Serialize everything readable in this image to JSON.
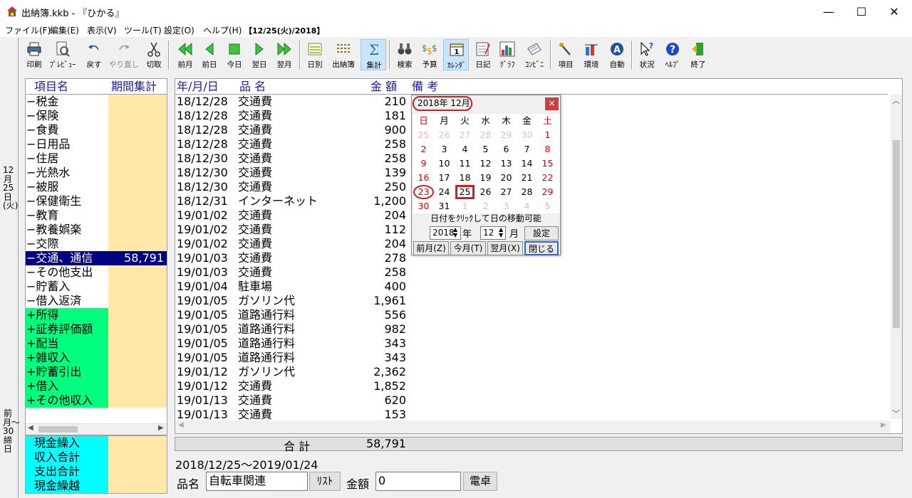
{
  "window": {
    "title": "出納簿.kkb - 『ひかる』",
    "minimize": "—",
    "maximize": "☐",
    "close": "✕"
  },
  "menu": [
    {
      "label": "ファイル(F)"
    },
    {
      "label": "編集(E)"
    },
    {
      "label": "表示(V)"
    },
    {
      "label": "ツール(T)"
    },
    {
      "label": "設定(O)"
    },
    {
      "label": "ヘルプ(H)"
    },
    {
      "label": "【12/25(火)/2018】"
    }
  ],
  "toolbar": [
    {
      "label": "印刷",
      "icon": "printer-icon"
    },
    {
      "label": "ﾌﾟﾚﾋﾞｭｰ",
      "icon": "preview-icon"
    },
    {
      "label": "戻す",
      "icon": "undo-icon"
    },
    {
      "label": "やり直し",
      "icon": "redo-icon"
    },
    {
      "label": "切取",
      "icon": "scissors-icon"
    },
    {
      "label": "前月",
      "icon": "double-left-icon"
    },
    {
      "label": "前日",
      "icon": "left-icon"
    },
    {
      "label": "今日",
      "icon": "square-icon"
    },
    {
      "label": "翌日",
      "icon": "right-icon"
    },
    {
      "label": "翌月",
      "icon": "double-right-icon"
    },
    {
      "label": "日別",
      "icon": "daily-icon"
    },
    {
      "label": "出納簿",
      "icon": "ledger-icon"
    },
    {
      "label": "集計",
      "icon": "sigma-icon"
    },
    {
      "label": "検索",
      "icon": "binoculars-icon"
    },
    {
      "label": "予算",
      "icon": "budget-icon"
    },
    {
      "label": "ｶﾚﾝﾀﾞ",
      "icon": "calendar-icon"
    },
    {
      "label": "日記",
      "icon": "diary-icon"
    },
    {
      "label": "ｸﾞﾗﾌ",
      "icon": "graph-icon"
    },
    {
      "label": "ｺﾝﾋﾞﾆ",
      "icon": "receipt-icon"
    },
    {
      "label": "項目",
      "icon": "items-icon"
    },
    {
      "label": "環境",
      "icon": "environment-icon"
    },
    {
      "label": "自動",
      "icon": "auto-icon"
    },
    {
      "label": "状況",
      "icon": "status-icon"
    },
    {
      "label": "ﾍﾙﾌﾟ",
      "icon": "help-icon"
    },
    {
      "label": "終了",
      "icon": "exit-icon"
    }
  ],
  "vertical_strip": {
    "date": "12月25日(火)",
    "period": "前月〜30締日"
  },
  "left_panel": {
    "header_name": "項目名",
    "header_total": "期間集計",
    "items": [
      {
        "name": "−税金",
        "amount": ""
      },
      {
        "name": "−保険",
        "amount": ""
      },
      {
        "name": "−食費",
        "amount": ""
      },
      {
        "name": "−日用品",
        "amount": ""
      },
      {
        "name": "−住居",
        "amount": ""
      },
      {
        "name": "−光熱水",
        "amount": ""
      },
      {
        "name": "−被服",
        "amount": ""
      },
      {
        "name": "−保健衛生",
        "amount": ""
      },
      {
        "name": "−教育",
        "amount": ""
      },
      {
        "name": "−教養娯楽",
        "amount": ""
      },
      {
        "name": "−交際",
        "amount": ""
      },
      {
        "name": "−交通、通信",
        "amount": "58,791"
      },
      {
        "name": "−その他支出",
        "amount": ""
      },
      {
        "name": "−貯蓄入",
        "amount": ""
      },
      {
        "name": "−借入返済",
        "amount": ""
      },
      {
        "name": "+所得",
        "amount": ""
      },
      {
        "name": "+証券評価額",
        "amount": ""
      },
      {
        "name": "+配当",
        "amount": ""
      },
      {
        "name": "+雑収入",
        "amount": ""
      },
      {
        "name": "+貯蓄引出",
        "amount": ""
      },
      {
        "name": "+借入",
        "amount": ""
      },
      {
        "name": "+その他収入",
        "amount": ""
      }
    ],
    "totals": [
      {
        "name": "現金繰入"
      },
      {
        "name": "収入合計"
      },
      {
        "name": "支出合計"
      },
      {
        "name": "現金繰越"
      }
    ]
  },
  "main_list": {
    "header_date": "年/月/日",
    "header_item": "品 名",
    "header_amount": "金 額",
    "header_note": "備 考",
    "rows": [
      {
        "date": "18/12/28",
        "item": "交通費",
        "amount": "210"
      },
      {
        "date": "18/12/28",
        "item": "交通費",
        "amount": "181"
      },
      {
        "date": "18/12/28",
        "item": "交通費",
        "amount": "900"
      },
      {
        "date": "18/12/28",
        "item": "交通費",
        "amount": "258"
      },
      {
        "date": "18/12/30",
        "item": "交通費",
        "amount": "258"
      },
      {
        "date": "18/12/30",
        "item": "交通費",
        "amount": "139"
      },
      {
        "date": "18/12/30",
        "item": "交通費",
        "amount": "250"
      },
      {
        "date": "18/12/31",
        "item": "インターネット",
        "amount": "1,200"
      },
      {
        "date": "19/01/02",
        "item": "交通費",
        "amount": "204"
      },
      {
        "date": "19/01/02",
        "item": "交通費",
        "amount": "112"
      },
      {
        "date": "19/01/02",
        "item": "交通費",
        "amount": "204"
      },
      {
        "date": "19/01/03",
        "item": "交通費",
        "amount": "278"
      },
      {
        "date": "19/01/03",
        "item": "交通費",
        "amount": "258"
      },
      {
        "date": "19/01/04",
        "item": "駐車場",
        "amount": "400"
      },
      {
        "date": "19/01/05",
        "item": "ガソリン代",
        "amount": "1,961"
      },
      {
        "date": "19/01/05",
        "item": "道路通行料",
        "amount": "556"
      },
      {
        "date": "19/01/05",
        "item": "道路通行料",
        "amount": "982"
      },
      {
        "date": "19/01/05",
        "item": "道路通行料",
        "amount": "343"
      },
      {
        "date": "19/01/05",
        "item": "道路通行料",
        "amount": "343"
      },
      {
        "date": "19/01/12",
        "item": "ガソリン代",
        "amount": "2,362"
      },
      {
        "date": "19/01/12",
        "item": "交通費",
        "amount": "1,852"
      },
      {
        "date": "19/01/13",
        "item": "交通費",
        "amount": "620"
      },
      {
        "date": "19/01/13",
        "item": "交通費",
        "amount": "153"
      }
    ],
    "sum_label": "合 計",
    "sum_value": "58,791"
  },
  "calendar": {
    "title": "2018年 12月",
    "close": "×",
    "weekdays": [
      "日",
      "月",
      "火",
      "水",
      "木",
      "金",
      "土"
    ],
    "days": [
      "25",
      "26",
      "27",
      "28",
      "29",
      "30",
      "1",
      "2",
      "3",
      "4",
      "5",
      "6",
      "7",
      "8",
      "9",
      "10",
      "11",
      "12",
      "13",
      "14",
      "15",
      "16",
      "17",
      "18",
      "19",
      "20",
      "21",
      "22",
      "23",
      "24",
      "25",
      "26",
      "27",
      "28",
      "29",
      "30",
      "31",
      "1",
      "2",
      "3",
      "4",
      "5"
    ],
    "hint": "日付をｸﾘｯｸして日の移動可能",
    "year_value": "2018",
    "year_unit": "年",
    "month_value": "12",
    "month_unit": "月",
    "set_button": "設定",
    "prev_month": "前月(Z)",
    "this_month": "今月(T)",
    "next_month": "翌月(X)",
    "close_button": "閉じる"
  },
  "footer": {
    "range": "2018/12/25～2019/01/24",
    "item_label": "品名",
    "item_value": "自転車関連",
    "list_button": "ﾘｽﾄ",
    "amount_label": "金額",
    "amount_value": "0",
    "calc_button": "電卓"
  },
  "colors": {
    "selected_bg": "#000080",
    "income_bg": "#00ff7f",
    "total_name_bg": "#00ffff",
    "amount_bg": "#ffe8a8",
    "calendar_red": "#e00000",
    "calendar_circle": "#d02020"
  }
}
